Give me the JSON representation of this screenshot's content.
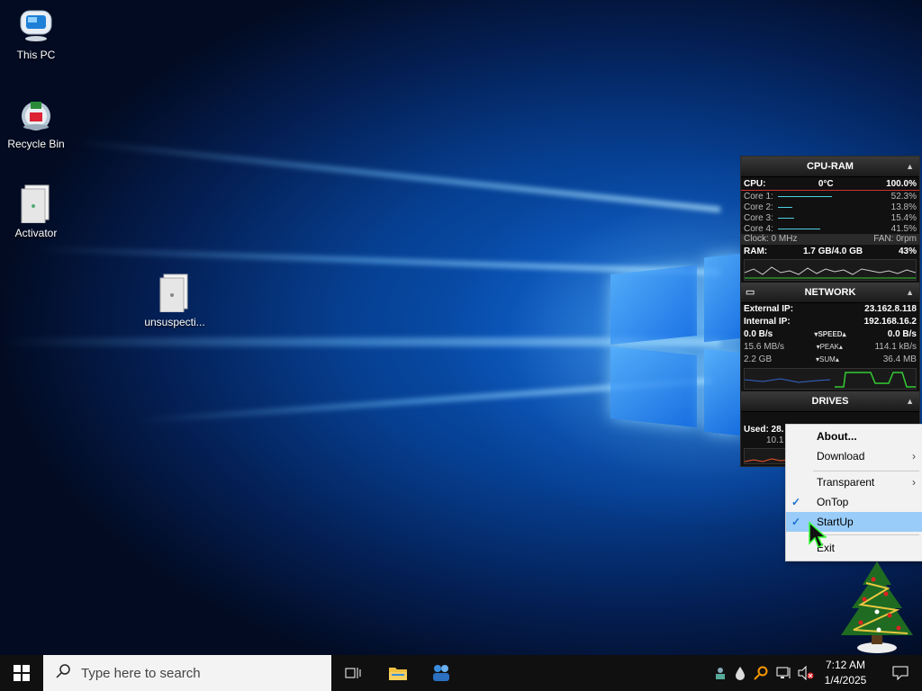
{
  "desktop_icons": {
    "this_pc": "This PC",
    "recycle_bin": "Recycle Bin",
    "activator": "Activator",
    "unsuspecting": "unsuspecti..."
  },
  "widget": {
    "cpu_ram": {
      "title": "CPU-RAM",
      "cpu_label": "CPU:",
      "cpu_temp": "0°C",
      "cpu_usage": "100.0%",
      "cores": [
        {
          "label": "Core 1:",
          "value": "52.3%",
          "level": 0.523
        },
        {
          "label": "Core 2:",
          "value": "13.8%",
          "level": 0.138
        },
        {
          "label": "Core 3:",
          "value": "15.4%",
          "level": 0.154
        },
        {
          "label": "Core 4:",
          "value": "41.5%",
          "level": 0.415
        }
      ],
      "clock": "Clock: 0 MHz",
      "fan": "FAN: 0rpm",
      "ram_label": "RAM:",
      "ram_value": "1.7 GB/4.0 GB",
      "ram_pct": "43%"
    },
    "network": {
      "title": "NETWORK",
      "external_ip_label": "External IP:",
      "external_ip": "23.162.8.118",
      "internal_ip_label": "Internal IP:",
      "internal_ip": "192.168.16.2",
      "speed_down": "0.0 B/s",
      "speed_tag": "SPEED",
      "speed_up": "0.0 B/s",
      "peak_down": "15.6 MB/s",
      "peak_tag": "PEAK",
      "peak_up": "114.1 kB/s",
      "sum_down": "2.2 GB",
      "sum_tag": "SUM",
      "sum_up": "36.4 MB"
    },
    "drives": {
      "title": "DRIVES",
      "used_label": "Used: 28.",
      "used_val": "10.1"
    }
  },
  "context_menu": {
    "items": [
      "About...",
      "Download",
      "Transparent",
      "OnTop",
      "StartUp",
      "Exit"
    ]
  },
  "taskbar": {
    "search_placeholder": "Type here to search",
    "time": "7:12 AM",
    "date": "1/4/2025"
  },
  "colors": {
    "taskbar_bg": "#101010",
    "menu_highlight": "#99ccf8",
    "accent": "#1a6fd0"
  }
}
